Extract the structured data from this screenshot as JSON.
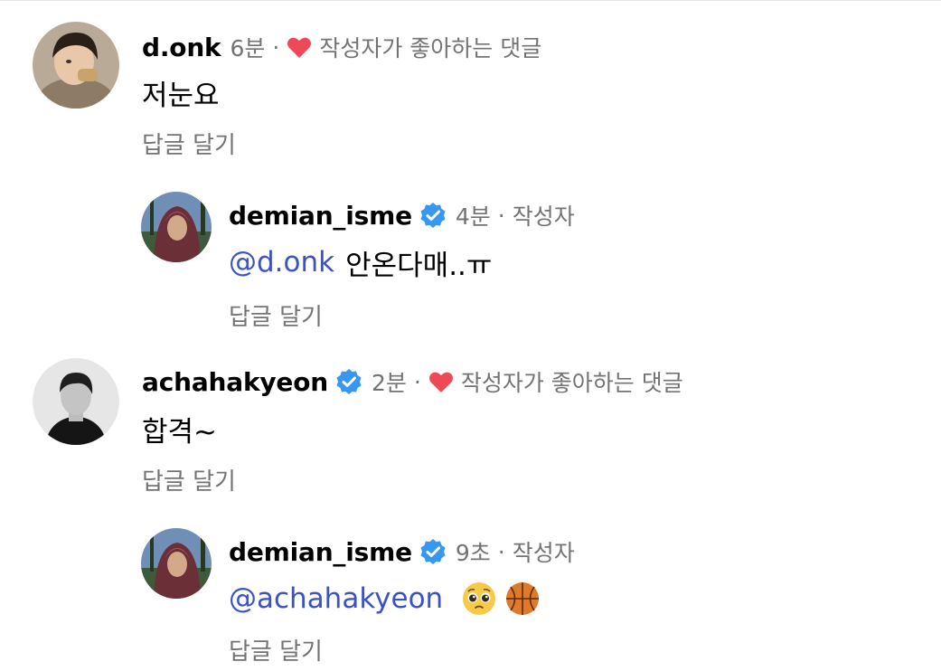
{
  "comments": [
    {
      "username": "d.onk",
      "time": "6분",
      "separator": "·",
      "liked_label": "작성자가 좋아하는 댓글",
      "text": "저눈요",
      "reply_label": "답글 달기"
    },
    {
      "username": "demian_isme",
      "verified": true,
      "time": "4분",
      "separator": "·",
      "author_label": "작성자",
      "mention": "@d.onk",
      "text": "안온다매..ㅠ",
      "reply_label": "답글 달기"
    },
    {
      "username": "achahakyeon",
      "verified": true,
      "time": "2분",
      "separator": "·",
      "liked_label": "작성자가 좋아하는 댓글",
      "text": "합격~",
      "reply_label": "답글 달기"
    },
    {
      "username": "demian_isme",
      "verified": true,
      "time": "9초",
      "separator": "·",
      "author_label": "작성자",
      "mention": "@achahakyeon",
      "emojis": [
        "pleading-face-emoji",
        "basketball-emoji"
      ],
      "reply_label": "답글 달기"
    }
  ],
  "colors": {
    "heart": "#ed4956",
    "verified": "#3897f0",
    "mention": "#3b52c4",
    "meta": "#737373"
  }
}
